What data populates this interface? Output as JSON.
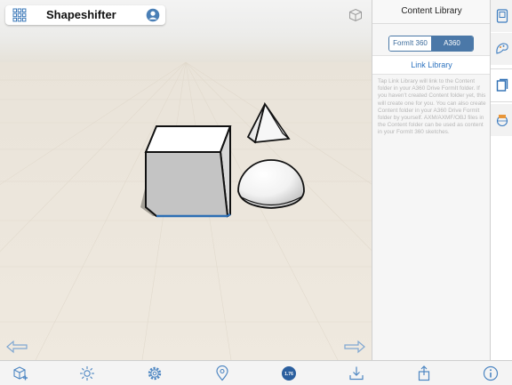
{
  "app": {
    "title": "Shapeshifter"
  },
  "panel": {
    "title": "Content Library",
    "segments": [
      "FormIt 360",
      "A360"
    ],
    "selected_segment": "A360",
    "link_label": "Link Library",
    "info_text": "Tap Link Library will link to the Content folder in your A360 Drive FormIt folder. If you haven't created Content folder yet, this will create one for you. You can also create Content folder in your A360 Drive FormIt folder by yourself. AXM/AXMF/OBJ files in the Content folder can be used as content in your FormIt 360 sketches."
  },
  "side_tabs": [
    "properties-icon",
    "materials-icon",
    "content-library-icon",
    "geolocation-icon"
  ],
  "toolbar": {
    "icons": [
      "add-object-icon",
      "sun-icon",
      "settings-icon",
      "location-pin-icon",
      "level-badge-icon",
      "import-icon",
      "share-icon",
      "info-icon"
    ],
    "badge_label": "1.76"
  },
  "colors": {
    "accent": "#4b78a8",
    "link": "#2f74c0",
    "toolbar_icon": "#4d86c2",
    "edge_highlight": "#2d6fb5"
  }
}
